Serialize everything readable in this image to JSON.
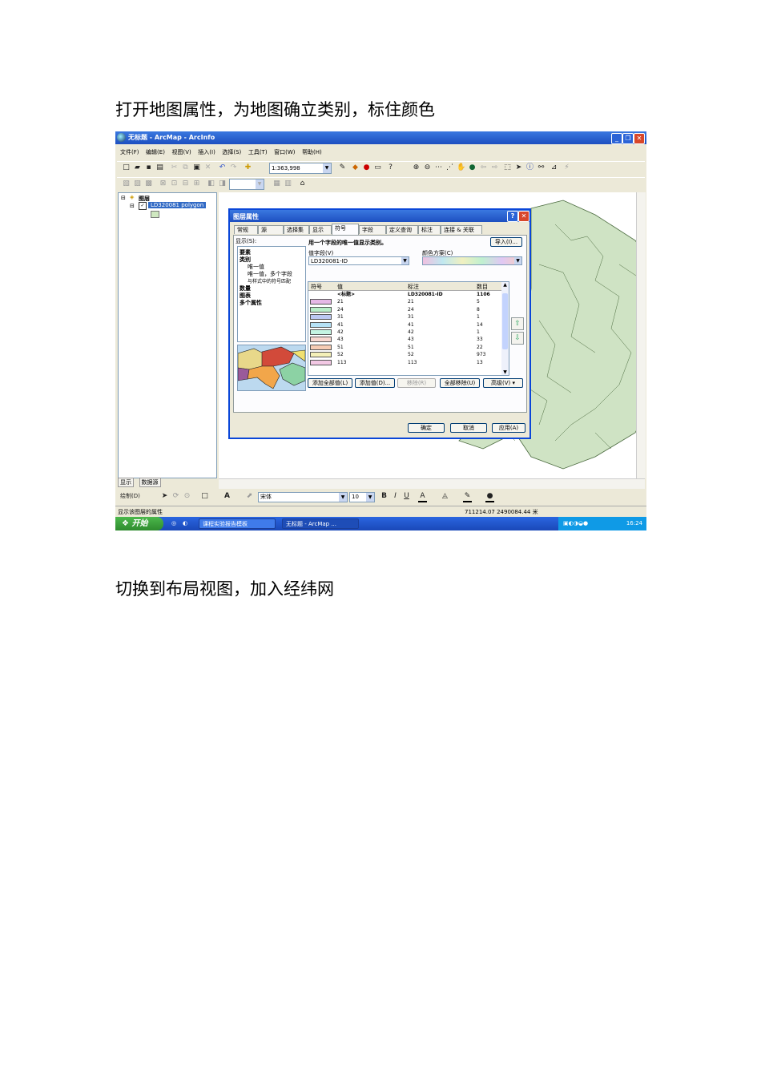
{
  "headings": {
    "h1": "打开地图属性，为地图确立类别，标住颜色",
    "h2": "切换到布局视图，加入经纬网"
  },
  "window": {
    "title": "无标题 - ArcMap - ArcInfo",
    "controls": [
      "_",
      "❐",
      "✕"
    ]
  },
  "menu": [
    "文件(F)",
    "编辑(E)",
    "视图(V)",
    "插入(I)",
    "选择(S)",
    "工具(T)",
    "窗口(W)",
    "帮助(H)"
  ],
  "toolbar": {
    "scale": "1:363,998"
  },
  "toc": {
    "root": "图层",
    "layer": "LD320081 polygon",
    "tabs": [
      "显示",
      "数据源"
    ]
  },
  "dialog": {
    "title": "图层属性",
    "tabs": [
      "常规",
      "源",
      "选择集",
      "显示",
      "符号",
      "字段",
      "定义查询",
      "标注",
      "连接 & 关联"
    ],
    "active_tab": "符号",
    "show_label": "显示(S):",
    "show_items": [
      {
        "text": "要素",
        "bold": true
      },
      {
        "text": "类别",
        "bold": true
      },
      {
        "text": "唯一值",
        "bold": false
      },
      {
        "text": "唯一值，多个字段",
        "bold": false
      },
      {
        "text": "与样式中的符号匹配",
        "bold": false
      },
      {
        "text": "数量",
        "bold": true
      },
      {
        "text": "图表",
        "bold": true
      },
      {
        "text": "多个属性",
        "bold": true
      }
    ],
    "description": "用一个字段的唯一值显示类别。",
    "import_button": "导入(I)...",
    "value_field_label": "值字段(V)",
    "value_field": "LD320081-ID",
    "color_scheme_label": "颜色方案(C)",
    "table_headers": [
      "符号",
      "值",
      "标注",
      "数目"
    ],
    "rows": [
      {
        "value": "<标题>",
        "label": "LD320081-ID",
        "count": "1106",
        "color": ""
      },
      {
        "value": "21",
        "label": "21",
        "count": "5",
        "color": "#e6b8e6"
      },
      {
        "value": "24",
        "label": "24",
        "count": "8",
        "color": "#b8eec8"
      },
      {
        "value": "31",
        "label": "31",
        "count": "1",
        "color": "#bcc8f2"
      },
      {
        "value": "41",
        "label": "41",
        "count": "14",
        "color": "#b6e2f6"
      },
      {
        "value": "42",
        "label": "42",
        "count": "1",
        "color": "#c4f4e2"
      },
      {
        "value": "43",
        "label": "43",
        "count": "33",
        "color": "#f8d8d0"
      },
      {
        "value": "51",
        "label": "51",
        "count": "22",
        "color": "#f6ccb4"
      },
      {
        "value": "52",
        "label": "52",
        "count": "973",
        "color": "#f4f0b8"
      },
      {
        "value": "113",
        "label": "113",
        "count": "13",
        "color": "#f2c8e4"
      }
    ],
    "buttons": {
      "add_all": "添加全部值(L)",
      "add_values": "添加值(D)...",
      "remove": "移除(R)",
      "remove_all": "全部移除(U)",
      "advanced": "高级(V)"
    },
    "footer": {
      "ok": "确定",
      "cancel": "取消",
      "apply": "应用(A)"
    }
  },
  "drawing_toolbar": {
    "draw": "绘制(D)",
    "font": "宋体",
    "size": "10"
  },
  "status": {
    "left": "显示该图层的属性",
    "coords": "711214.07  2490084.44 米"
  },
  "taskbar": {
    "start": "开始",
    "items": [
      "课程实验报告模板",
      "无标题 - ArcMap ..."
    ],
    "clock": "16:24"
  },
  "colors": {
    "title_blue": "#1d4fc0",
    "start_green": "#2e8b2e",
    "map_green": "#cfe3c4"
  }
}
